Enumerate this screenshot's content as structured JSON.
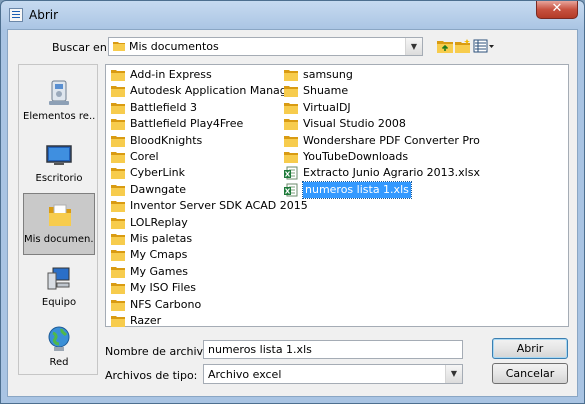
{
  "window": {
    "title": "Abrir",
    "close_glyph": "✕"
  },
  "lookin": {
    "label": "Buscar en:",
    "value": "Mis documentos"
  },
  "toolbar": {
    "icons": [
      "up-folder-icon",
      "new-folder-icon",
      "view-menu-icon"
    ]
  },
  "sidebar": {
    "items": [
      {
        "label": "Elementos re...",
        "icon": "recent-items-icon"
      },
      {
        "label": "Escritorio",
        "icon": "desktop-icon"
      },
      {
        "label": "Mis documen...",
        "icon": "documents-icon",
        "selected": true
      },
      {
        "label": "Equipo",
        "icon": "computer-icon"
      },
      {
        "label": "Red",
        "icon": "network-icon"
      }
    ]
  },
  "files": {
    "col1": [
      "Add-in Express",
      "Autodesk Application Manager",
      "Battlefield 3",
      "Battlefield Play4Free",
      "BloodKnights",
      "Corel",
      "CyberLink",
      "Dawngate",
      "Inventor Server SDK ACAD 2015",
      "LOLReplay",
      "Mis paletas",
      "My Cmaps",
      "My Games",
      "My ISO Files",
      "NFS Carbono",
      "Razer"
    ],
    "col2_folders": [
      "samsung",
      "Shuame",
      "VirtualDJ",
      "Visual Studio 2008",
      "Wondershare PDF Converter Pro",
      "YouTubeDownloads"
    ],
    "col2_files": [
      "Extracto Junio Agrario 2013.xlsx",
      "numeros lista 1.xls"
    ],
    "selected": "numeros lista 1.xls"
  },
  "filename": {
    "label": "Nombre de archivo:",
    "value": "numeros lista 1.xls"
  },
  "filetype": {
    "label": "Archivos de tipo:",
    "value": "Archivo excel"
  },
  "buttons": {
    "open": "Abrir",
    "cancel": "Cancelar"
  }
}
